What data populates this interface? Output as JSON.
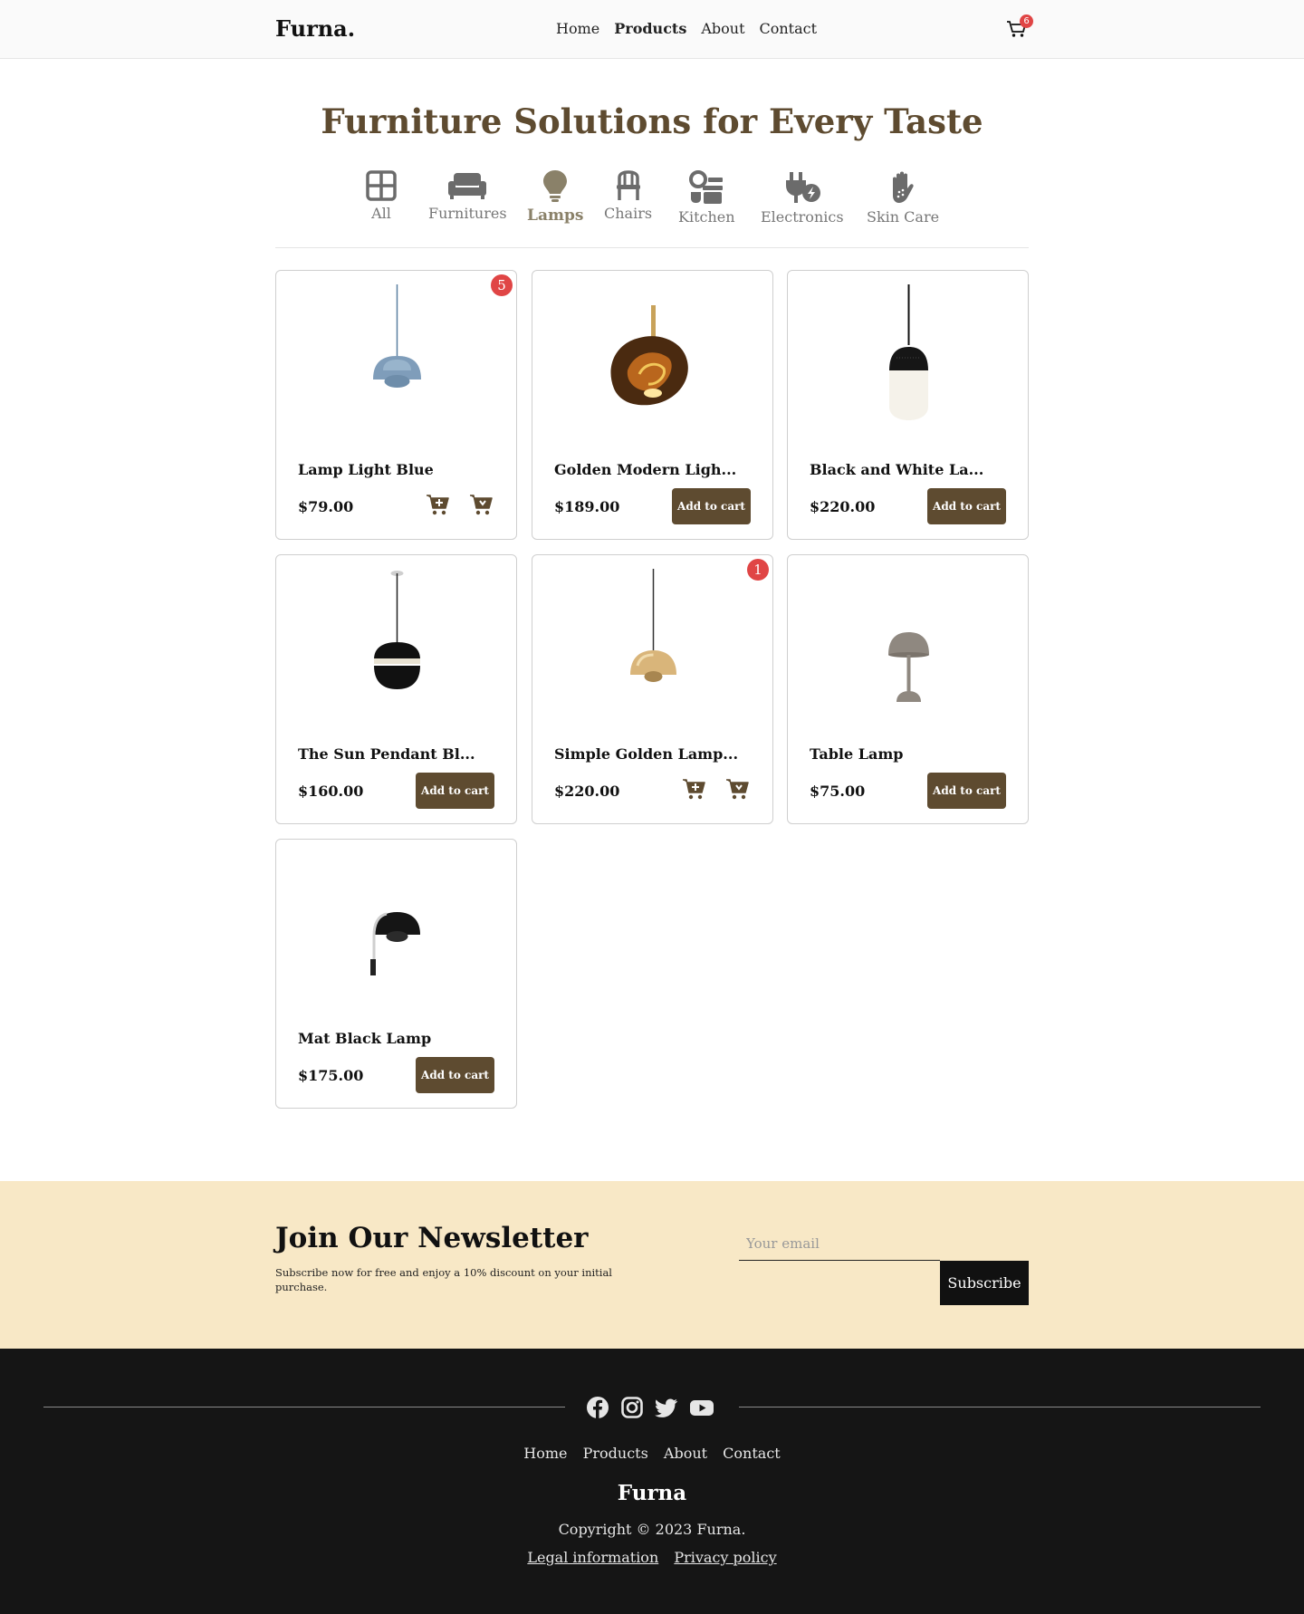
{
  "header": {
    "logo": "Furna.",
    "nav": [
      "Home",
      "Products",
      "About",
      "Contact"
    ],
    "active_nav": "Products",
    "cart_count": "6",
    "cart_icon": "cart-icon"
  },
  "page": {
    "title": "Furniture Solutions for Every Taste"
  },
  "categories": [
    {
      "label": "All",
      "icon": "grid-icon",
      "active": false
    },
    {
      "label": "Furnitures",
      "icon": "sofa-icon",
      "active": false
    },
    {
      "label": "Lamps",
      "icon": "lightbulb-icon",
      "active": true
    },
    {
      "label": "Chairs",
      "icon": "chair-icon",
      "active": false
    },
    {
      "label": "Kitchen",
      "icon": "kitchen-icon",
      "active": false
    },
    {
      "label": "Electronics",
      "icon": "plug-icon",
      "active": false
    },
    {
      "label": "Skin Care",
      "icon": "hand-icon",
      "active": false
    }
  ],
  "products": [
    {
      "name": "Lamp Light Blue",
      "price": "$79.00",
      "in_cart": "5",
      "image": "blue-pendant-lamp"
    },
    {
      "name": "Golden Modern Ligh...",
      "price": "$189.00",
      "button": "Add to cart",
      "image": "golden-molten-pendant"
    },
    {
      "name": "Black and White La...",
      "price": "$220.00",
      "button": "Add to cart",
      "image": "black-white-pendant"
    },
    {
      "name": "The Sun Pendant Bl...",
      "price": "$160.00",
      "button": "Add to cart",
      "image": "sun-pendant-black"
    },
    {
      "name": "Simple Golden Lamp...",
      "price": "$220.00",
      "in_cart": "1",
      "image": "golden-dome-pendant"
    },
    {
      "name": "Table Lamp",
      "price": "$75.00",
      "button": "Add to cart",
      "image": "taupe-table-lamp"
    },
    {
      "name": "Mat Black Lamp",
      "price": "$175.00",
      "button": "Add to cart",
      "image": "black-wall-lamp"
    }
  ],
  "newsletter": {
    "title": "Join Our Newsletter",
    "text": "Subscribe now for free and enjoy a 10% discount on your initial purchase.",
    "placeholder": "Your email",
    "button": "Subscribe"
  },
  "footer": {
    "social": [
      "facebook-icon",
      "instagram-icon",
      "twitter-icon",
      "youtube-icon"
    ],
    "nav": [
      "Home",
      "Products",
      "About",
      "Contact"
    ],
    "brand": "Furna",
    "copyright": "Copyright © 2023 Furna.",
    "legal": [
      "Legal information",
      "Privacy policy"
    ]
  },
  "colors": {
    "accent": "#5e4b30",
    "badge": "#e04545",
    "newsletter_bg": "#f8e8c6",
    "footer_bg": "#151515"
  }
}
